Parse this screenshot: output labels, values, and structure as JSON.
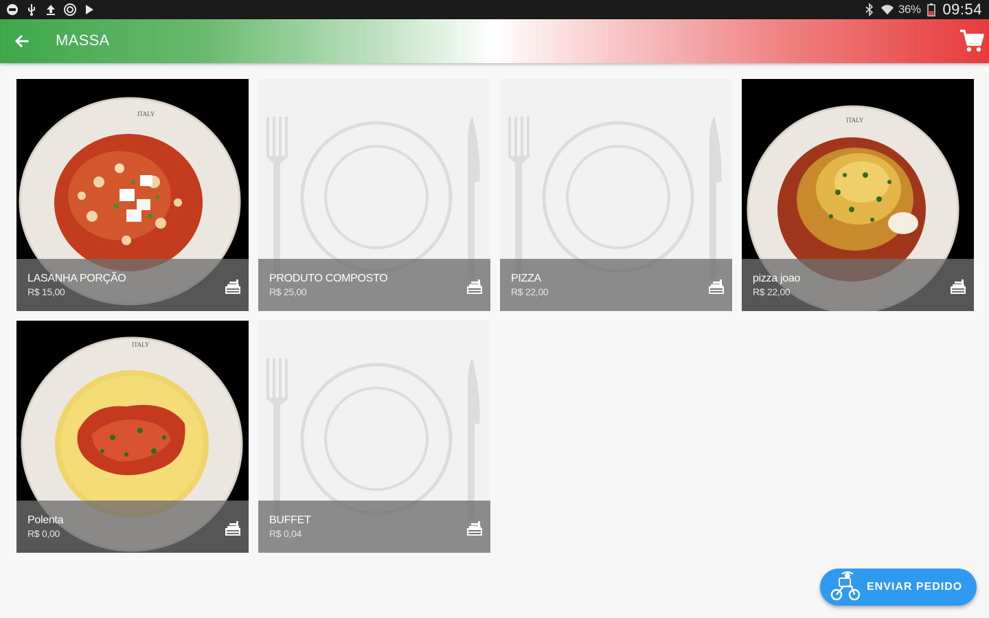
{
  "status_bar": {
    "battery_text": "36%",
    "time": "09:54",
    "left_icons": [
      "message-icon",
      "usb-icon",
      "upload-icon",
      "sync-icon",
      "play-store-icon"
    ],
    "right_icons": [
      "bluetooth-icon",
      "wifi-icon",
      "battery-icon"
    ]
  },
  "app_bar": {
    "title": "MASSA",
    "back_icon": "arrow-left-icon",
    "cart_icon": "shopping-cart-icon",
    "gradient_colors": [
      "#3da84a",
      "#ffffff",
      "#e63b3b"
    ]
  },
  "products": [
    {
      "name": "LASANHA PORÇÃO",
      "price": "R$ 15,00",
      "image": "photo-tomato-pasta"
    },
    {
      "name": "PRODUTO COMPOSTO",
      "price": "R$ 25,00",
      "image": "placeholder-plate"
    },
    {
      "name": "PIZZA",
      "price": "R$ 22,00",
      "image": "placeholder-plate"
    },
    {
      "name": "pizza joao",
      "price": "R$ 22,00",
      "image": "photo-lasagna"
    },
    {
      "name": "Polenta",
      "price": "R$ 0,00",
      "image": "photo-polenta"
    },
    {
      "name": "BUFFET",
      "price": "R$ 0,04",
      "image": "placeholder-plate"
    }
  ],
  "fab": {
    "label": "ENVIAR PEDIDO",
    "icon": "delivery-scooter-icon",
    "color": "#2f9af0"
  }
}
